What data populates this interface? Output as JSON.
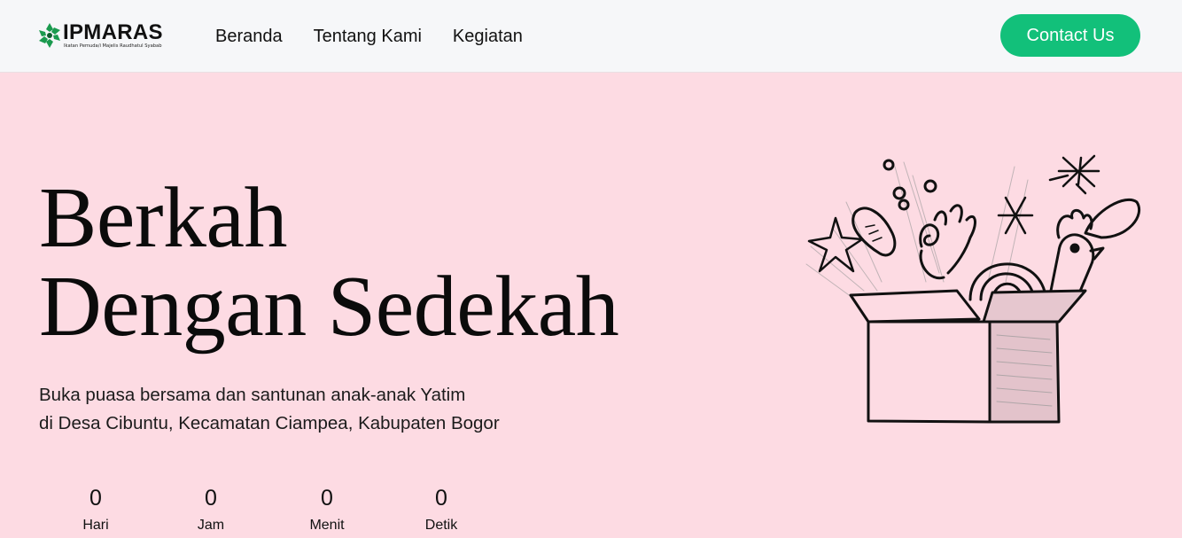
{
  "header": {
    "brand_name": "IPMARAS",
    "brand_tagline": "Ikatan Pemuda/i Majelis Raudhatul Syabab",
    "nav": [
      {
        "label": "Beranda"
      },
      {
        "label": "Tentang Kami"
      },
      {
        "label": "Kegiatan"
      }
    ],
    "contact_label": "Contact Us"
  },
  "hero": {
    "title_line1": "Berkah",
    "title_line2": "Dengan Sedekah",
    "subtitle_line1": "Buka puasa bersama dan santunan anak-anak Yatim",
    "subtitle_line2": "di Desa Cibuntu, Kecamatan Ciampea, Kabupaten Bogor"
  },
  "countdown": [
    {
      "value": "0",
      "label": "Hari"
    },
    {
      "value": "0",
      "label": "Jam"
    },
    {
      "value": "0",
      "label": "Menit"
    },
    {
      "value": "0",
      "label": "Detik"
    }
  ],
  "colors": {
    "background": "#fddbe3",
    "navbar": "#f6f7f9",
    "accent": "#12c07a",
    "text": "#111111"
  },
  "icons": {
    "brand": "ipmaras-logo-icon",
    "illustration": "gift-box-illustration"
  }
}
